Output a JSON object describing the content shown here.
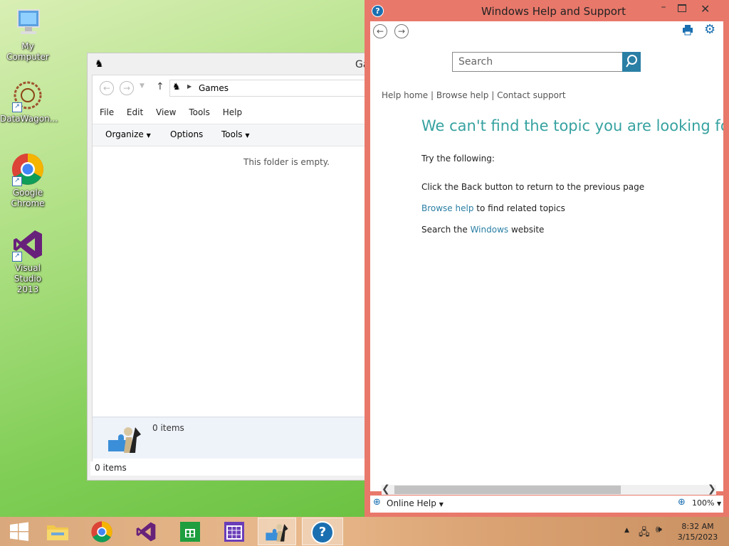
{
  "desktop": {
    "icons": [
      {
        "label": "My Computer"
      },
      {
        "label": "DataWagon..."
      },
      {
        "label": "Google Chrome"
      },
      {
        "label": "Visual Studio 2013"
      }
    ]
  },
  "explorer": {
    "title": "Ga",
    "address_path": "Games",
    "menu": [
      "File",
      "Edit",
      "View",
      "Tools",
      "Help"
    ],
    "toolbar": {
      "organize": "Organize",
      "options": "Options",
      "tools": "Tools"
    },
    "empty_message": "This folder is empty.",
    "details_count": "0 items",
    "status_count": "0 items"
  },
  "help": {
    "title": "Windows Help and Support",
    "search_placeholder": "Search",
    "nav_links": {
      "home": "Help home",
      "sep1": "|",
      "browse": "Browse help",
      "sep2": "|",
      "contact": "Contact support"
    },
    "heading": "We can't find the topic you are looking for",
    "try_text": "Try the following:",
    "line1": "Click the Back button to return to the previous page",
    "line2_link": "Browse help",
    "line2_rest": " to find related topics",
    "line3_pre": "Search the ",
    "line3_link": "Windows",
    "line3_post": " website",
    "online_help": "Online Help",
    "zoom": "100%",
    "accent": "#2a7fa5",
    "frame_color": "#e8786a"
  },
  "taskbar": {
    "time": "8:32 AM",
    "date": "3/15/2023"
  }
}
